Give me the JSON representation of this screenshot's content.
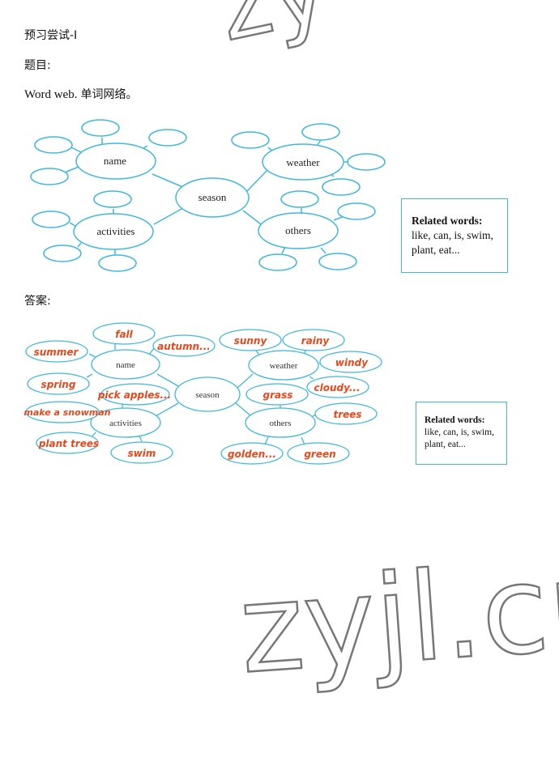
{
  "header": {
    "title": "预习尝试-I",
    "question_label": "题目:",
    "instruction_en": "Word web",
    "instruction_sep": ".",
    "instruction_cn": "单词网络。",
    "answer_label": "答案:"
  },
  "question_web": {
    "center": "season",
    "branches": [
      {
        "label": "name",
        "leaves": [
          "",
          "",
          "",
          ""
        ]
      },
      {
        "label": "weather",
        "leaves": [
          "",
          "",
          "",
          ""
        ]
      },
      {
        "label": "activities",
        "leaves": [
          "",
          "",
          "",
          ""
        ]
      },
      {
        "label": "others",
        "leaves": [
          "",
          "",
          "",
          ""
        ]
      }
    ]
  },
  "answer_web": {
    "center": "season",
    "branches": [
      {
        "label": "name",
        "leaves": [
          "fall",
          "autumn...",
          "summer",
          "spring"
        ]
      },
      {
        "label": "weather",
        "leaves": [
          "sunny",
          "rainy",
          "windy",
          "cloudy..."
        ]
      },
      {
        "label": "activities",
        "leaves": [
          "pick apples...",
          "make a snowman",
          "plant trees",
          "swim"
        ]
      },
      {
        "label": "others",
        "leaves": [
          "grass",
          "trees",
          "golden...",
          "green"
        ]
      }
    ]
  },
  "related_words": {
    "title": "Related words:",
    "line1": "like, can, is, swim,",
    "line2": "plant, eat..."
  },
  "colors": {
    "ellipse_stroke": "#3fb8e0",
    "answer_text": "#e8481c",
    "watermark": "#777777"
  },
  "watermark": {
    "text": "zyjl.cn"
  }
}
